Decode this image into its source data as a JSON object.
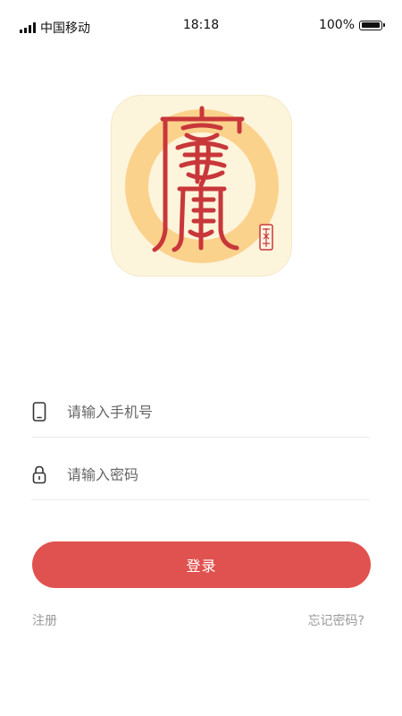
{
  "status_bar": {
    "carrier": "中国移动",
    "time": "18:18",
    "battery_percent": "100%",
    "battery_level": 1.0
  },
  "logo": {
    "icon": "seal-character-logo-icon",
    "colors": {
      "background": "#fdf4dc",
      "ring": "#fbd28c",
      "character": "#c8373a"
    }
  },
  "form": {
    "phone": {
      "icon": "phone-icon",
      "placeholder": "请输入手机号",
      "value": ""
    },
    "password": {
      "icon": "lock-icon",
      "placeholder": "请输入密码",
      "value": ""
    }
  },
  "actions": {
    "login_label": "登录",
    "register_label": "注册",
    "forgot_label": "忘记密码?"
  },
  "theme": {
    "accent": "#e0524f"
  }
}
